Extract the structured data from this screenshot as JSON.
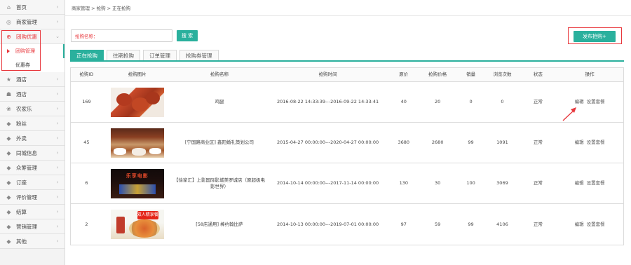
{
  "sidebar": {
    "items": [
      {
        "label": "首页",
        "icon": "home-icon"
      },
      {
        "label": "商家管理",
        "icon": "merchant-icon"
      },
      {
        "label": "团购优惠",
        "icon": "group-buy-icon"
      },
      {
        "label": "团购管理",
        "icon": ""
      },
      {
        "label": "优惠券",
        "icon": ""
      },
      {
        "label": "酒店",
        "icon": "star-icon"
      },
      {
        "label": "酒店",
        "icon": "hotel-icon"
      },
      {
        "label": "农家乐",
        "icon": "farm-icon"
      },
      {
        "label": "粉丝",
        "icon": "tag-icon"
      },
      {
        "label": "外卖",
        "icon": "tag-icon"
      },
      {
        "label": "同城信息",
        "icon": "tag-icon"
      },
      {
        "label": "众筹管理",
        "icon": "tag-icon"
      },
      {
        "label": "订座",
        "icon": "tag-icon"
      },
      {
        "label": "评价管理",
        "icon": "tag-icon"
      },
      {
        "label": "结算",
        "icon": "tag-icon"
      },
      {
        "label": "营销管理",
        "icon": "tag-icon"
      },
      {
        "label": "其他",
        "icon": "tag-icon"
      }
    ]
  },
  "breadcrumb": "商家管理 > 抢购 > 正在抢购",
  "search": {
    "label": "抢购名称：",
    "value": "",
    "button": "搜 索"
  },
  "publish_button": "发布抢购+",
  "tabs": [
    "正在抢购",
    "往期抢购",
    "订单管理",
    "抢购券管理"
  ],
  "table": {
    "headers": [
      "抢购ID",
      "抢购图片",
      "抢购名称",
      "抢购时间",
      "原价",
      "抢购价格",
      "销量",
      "浏览次数",
      "状态",
      "操作"
    ],
    "rows": [
      {
        "id": "169",
        "name": "鸡腿",
        "time": "2016-08-22 14:33:39---2016-09-22 14:33:41",
        "orig": "40",
        "price": "20",
        "sales": "0",
        "views": "0",
        "status": "正常",
        "edit": "编辑",
        "set": "设置套餐"
      },
      {
        "id": "45",
        "name": "[宁国路商业区] 鑫阳婚礼策划公司",
        "time": "2015-04-27 00:00:00---2020-04-27 00:00:00",
        "orig": "3680",
        "price": "2680",
        "sales": "99",
        "views": "1091",
        "status": "正常",
        "edit": "编辑",
        "set": "设置套餐"
      },
      {
        "id": "6",
        "name": "【徐家汇】上影国际影城美罗城店（原超极电影世界）",
        "time": "2014-10-14 00:00:00---2017-11-14 00:00:00",
        "orig": "130",
        "price": "30",
        "sales": "100",
        "views": "3069",
        "status": "正常",
        "edit": "编辑",
        "set": "设置套餐"
      },
      {
        "id": "2",
        "name": "[58店通用] 棒约翰比萨",
        "time": "2014-10-13 00:00:00---2019-07-01 00:00:00",
        "orig": "97",
        "price": "59",
        "sales": "99",
        "views": "4106",
        "status": "正常",
        "edit": "编辑",
        "set": "设置套餐"
      }
    ]
  },
  "images": {
    "thumb3_text": "乐享电影",
    "thumb4_badge": "双人精享餐"
  },
  "colors": {
    "accent": "#2ab09d",
    "highlight": "#e8383d"
  }
}
